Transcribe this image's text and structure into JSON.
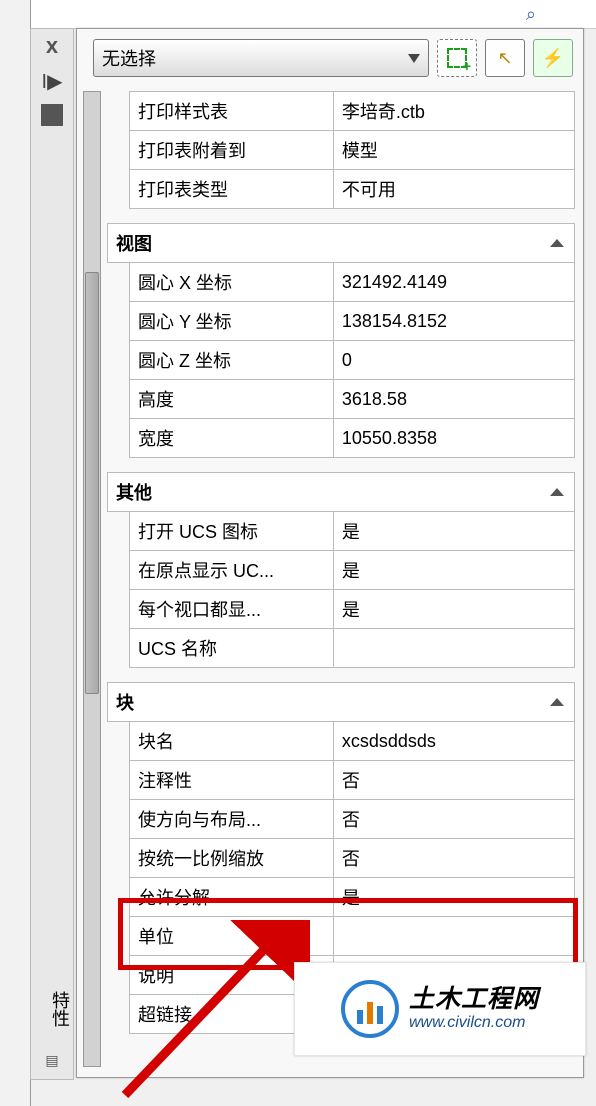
{
  "side": {
    "close": "x",
    "arrow": "I▶",
    "title": "特性"
  },
  "header": {
    "selection_label": "无选择"
  },
  "icons": {
    "select": "select-icon",
    "pick": "pick-icon",
    "quick": "quick-icon"
  },
  "print_rows": [
    {
      "label": "打印样式表",
      "value": "李培奇.ctb"
    },
    {
      "label": "打印表附着到",
      "value": "模型"
    },
    {
      "label": "打印表类型",
      "value": "不可用"
    }
  ],
  "sections": [
    {
      "title": "视图",
      "rows": [
        {
          "label": "圆心 X 坐标",
          "value": "321492.4149"
        },
        {
          "label": "圆心 Y 坐标",
          "value": "138154.8152"
        },
        {
          "label": "圆心 Z 坐标",
          "value": "0"
        },
        {
          "label": "高度",
          "value": "3618.58"
        },
        {
          "label": "宽度",
          "value": "10550.8358"
        }
      ]
    },
    {
      "title": "其他",
      "rows": [
        {
          "label": "打开 UCS 图标",
          "value": "是"
        },
        {
          "label": "在原点显示 UC...",
          "value": "是"
        },
        {
          "label": "每个视口都显...",
          "value": "是"
        },
        {
          "label": "UCS 名称",
          "value": ""
        }
      ]
    },
    {
      "title": "块",
      "rows": [
        {
          "label": "块名",
          "value": "xcsdsddsds"
        },
        {
          "label": "注释性",
          "value": "否"
        },
        {
          "label": "使方向与布局...",
          "value": "否"
        },
        {
          "label": "按统一比例缩放",
          "value": "否"
        },
        {
          "label": "允许分解",
          "value": "是"
        },
        {
          "label": "单位",
          "value": ""
        },
        {
          "label": "说明",
          "value": ""
        },
        {
          "label": "超链接",
          "value": ""
        }
      ]
    }
  ],
  "watermark": {
    "name": "土木工程网",
    "url": "www.civilcn.com"
  }
}
